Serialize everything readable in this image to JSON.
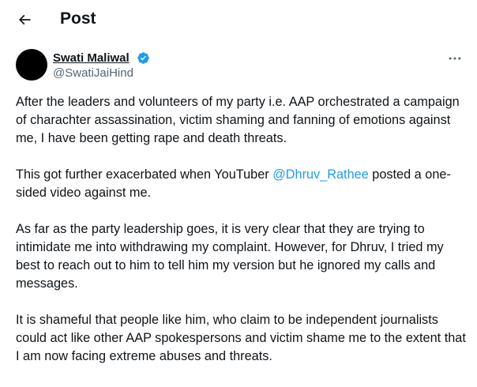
{
  "header": {
    "back_icon": "arrow-left-icon",
    "title": "Post"
  },
  "author": {
    "name": "Swati Maliwal",
    "handle": "@SwatiJaiHind",
    "verified_icon": "verified-badge-icon",
    "verified_color": "#1d9bf0"
  },
  "more_icon": "more-dots-icon",
  "tweet": {
    "para1": "After the leaders and volunteers of my party i.e. AAP orchestrated a campaign of charachter assassination, victim shaming and fanning of emotions against me, I have been getting rape and death threats.",
    "para2_before": "This got further exacerbated when YouTuber ",
    "para2_mention": "@Dhruv_Rathee",
    "para2_after": " posted a one-sided video against me.",
    "para3": "As far as the party leadership goes, it is very clear that they are trying to intimidate me into withdrawing my complaint. However, for Dhruv, I tried my best to reach out to him to tell him my version but he ignored my calls and messages.",
    "para4": "It is shameful that people like him, who claim to be independent journalists could act like other AAP spokespersons and victim shame me to the extent that I am now facing extreme abuses and threats."
  },
  "colors": {
    "text": "#0f1419",
    "secondary": "#536471",
    "link": "#1d9bf0"
  }
}
